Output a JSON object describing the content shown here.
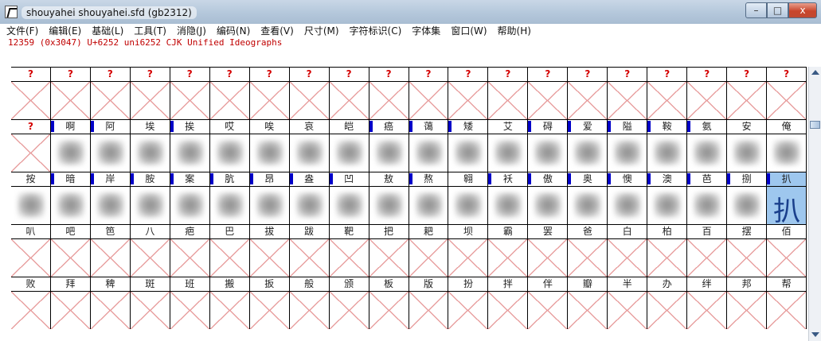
{
  "window": {
    "title": "shouyahei  shouyahei.sfd (gb2312)"
  },
  "window_controls": {
    "minimize": "–",
    "maximize": "□",
    "close": "x"
  },
  "menu": [
    "文件(F)",
    "编辑(E)",
    "基础(L)",
    "工具(T)",
    "消隐(J)",
    "编码(N)",
    "查看(V)",
    "尺寸(M)",
    "字符标识(C)",
    "字体集",
    "窗口(W)",
    "帮助(H)"
  ],
  "info_line": "12359  (0x3047)  U+6252   uni6252   CJK Unified Ideographs",
  "colors": {
    "info_text": "#c00000",
    "marker": "#0000c8",
    "selection": "#9ec7ee",
    "missing_label": "#d40000",
    "empty_cross": "#e8a0a0"
  },
  "grid": {
    "rows": [
      {
        "labels": [
          "?",
          "?",
          "?",
          "?",
          "?",
          "?",
          "?",
          "?",
          "?",
          "?",
          "?",
          "?",
          "?",
          "?",
          "?",
          "?",
          "?",
          "?",
          "?",
          "?"
        ],
        "marks": [],
        "cell_states": "empty"
      },
      {
        "labels": [
          "?",
          "啊",
          "阿",
          "埃",
          "挨",
          "哎",
          "唉",
          "哀",
          "皑",
          "癌",
          "蔼",
          "矮",
          "艾",
          "碍",
          "爱",
          "隘",
          "鞍",
          "氨",
          "安",
          "俺"
        ],
        "marks": [
          1,
          2,
          4,
          9,
          10,
          11,
          13,
          14,
          15,
          16,
          17
        ],
        "cell_states": "blur",
        "first_empty": true
      },
      {
        "labels": [
          "按",
          "暗",
          "岸",
          "胺",
          "案",
          "肮",
          "昂",
          "盎",
          "凹",
          "敖",
          "熬",
          "翱",
          "袄",
          "傲",
          "奥",
          "懊",
          "澳",
          "芭",
          "捌",
          "扒"
        ],
        "marks": [
          1,
          2,
          3,
          4,
          5,
          6,
          7,
          8,
          10,
          12,
          13,
          14,
          15,
          16,
          17,
          18,
          19
        ],
        "cell_states": "blur",
        "selected_index": 19,
        "selected_glyph": "扒"
      },
      {
        "labels": [
          "叭",
          "吧",
          "笆",
          "八",
          "疤",
          "巴",
          "拔",
          "跋",
          "靶",
          "把",
          "耙",
          "坝",
          "霸",
          "罢",
          "爸",
          "白",
          "柏",
          "百",
          "摆",
          "佰"
        ],
        "marks": [],
        "cell_states": "empty"
      },
      {
        "labels": [
          "败",
          "拜",
          "稗",
          "斑",
          "班",
          "搬",
          "扳",
          "般",
          "颁",
          "板",
          "版",
          "扮",
          "拌",
          "伴",
          "瓣",
          "半",
          "办",
          "绊",
          "邦",
          "帮"
        ],
        "marks": [],
        "cell_states": "empty"
      }
    ]
  },
  "scrollbar": {
    "up_icon": "scroll-up-arrow-icon",
    "down_icon": "scroll-down-arrow-icon"
  }
}
